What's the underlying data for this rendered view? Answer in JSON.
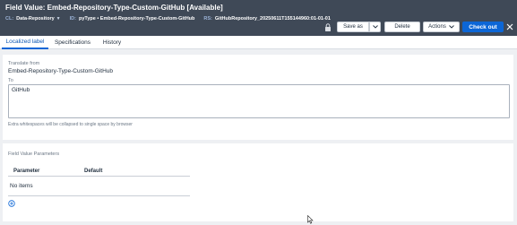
{
  "header": {
    "title": "Field Value: Embed-Repository-Type-Custom-GitHub [Available]",
    "meta": [
      {
        "key": "CL:",
        "value": "Data-Repository",
        "has_dropdown": true
      },
      {
        "key": "ID:",
        "value": "pyType • Embed-Repository-Type-Custom-GitHub",
        "has_dropdown": false
      },
      {
        "key": "RS:",
        "value": "GitHubRepository_20250611T155144960:01-01-01",
        "has_dropdown": false
      }
    ],
    "icons": {
      "lock": "lock-icon",
      "close": "close-icon",
      "caret": "chevron-down-icon"
    },
    "buttons": {
      "save_as": "Save as",
      "delete": "Delete",
      "actions": "Actions",
      "check_out": "Check out"
    },
    "colors": {
      "header_bg": "#3f4957",
      "primary": "#0c66d6",
      "meta_key": "#9ab2d6"
    }
  },
  "tabs": [
    {
      "label": "Localized label",
      "active": true
    },
    {
      "label": "Specifications",
      "active": false
    },
    {
      "label": "History",
      "active": false
    }
  ],
  "localized": {
    "translate_from_label": "Translate from",
    "translate_from_value": "Embed-Repository-Type-Custom-GitHub",
    "to_label": "To",
    "to_value": "GitHub",
    "hint": "Extra whitespaces will be collapsed to single space by browser"
  },
  "parameters": {
    "section_label": "Field Value Parameters",
    "columns": [
      "Parameter",
      "Default"
    ],
    "empty_text": "No items",
    "add_icon": "add-circle-icon"
  }
}
